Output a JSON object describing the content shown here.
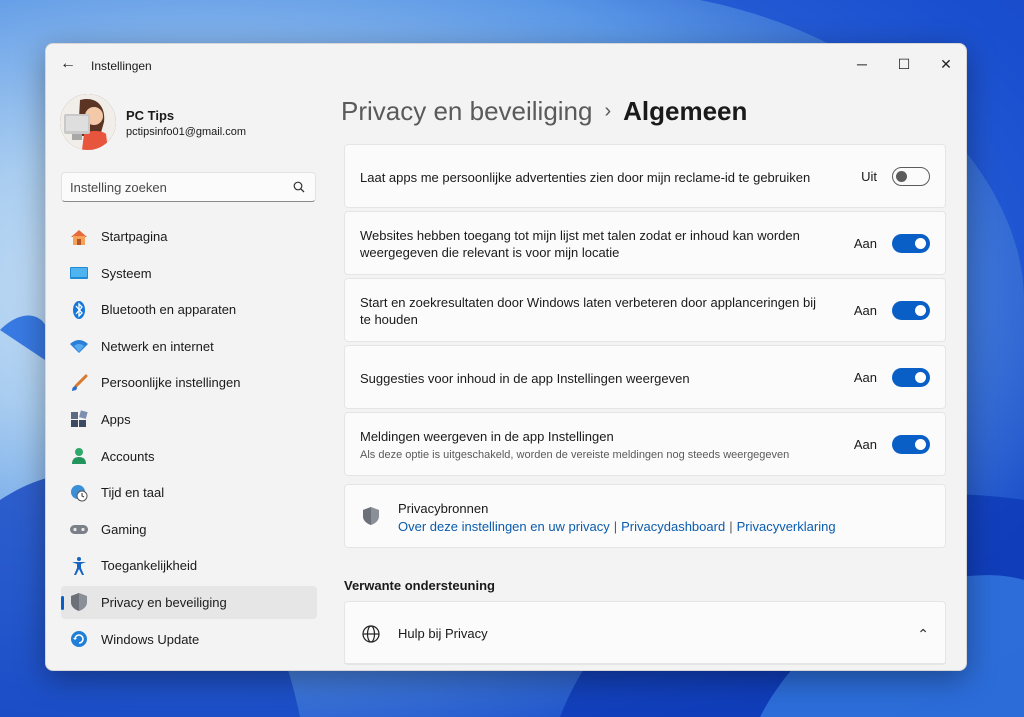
{
  "window": {
    "title": "Instellingen",
    "back_glyph": "←",
    "minimize_glyph": "─",
    "maximize_glyph": "☐",
    "close_glyph": "✕"
  },
  "profile": {
    "name": "PC Tips",
    "email": "pctipsinfo01@gmail.com"
  },
  "search": {
    "placeholder": "Instelling zoeken"
  },
  "sidebar": {
    "items": [
      {
        "label": "Startpagina",
        "icon": "home-icon"
      },
      {
        "label": "Systeem",
        "icon": "monitor-icon"
      },
      {
        "label": "Bluetooth en apparaten",
        "icon": "bluetooth-icon"
      },
      {
        "label": "Netwerk en internet",
        "icon": "wifi-icon"
      },
      {
        "label": "Persoonlijke instellingen",
        "icon": "brush-icon"
      },
      {
        "label": "Apps",
        "icon": "apps-icon"
      },
      {
        "label": "Accounts",
        "icon": "person-icon"
      },
      {
        "label": "Tijd en taal",
        "icon": "clock-globe-icon"
      },
      {
        "label": "Gaming",
        "icon": "gamepad-icon"
      },
      {
        "label": "Toegankelijkheid",
        "icon": "accessibility-icon"
      },
      {
        "label": "Privacy en beveiliging",
        "icon": "shield-icon",
        "active": true
      },
      {
        "label": "Windows Update",
        "icon": "update-icon"
      }
    ]
  },
  "breadcrumb": {
    "parent": "Privacy en beveiliging",
    "separator": "›",
    "current": "Algemeen"
  },
  "settings": [
    {
      "text": "Laat apps me persoonlijke advertenties zien door mijn reclame-id te gebruiken",
      "state": "Uit",
      "on": false
    },
    {
      "text": "Websites hebben toegang tot mijn lijst met talen zodat er inhoud kan worden weergegeven die relevant is voor mijn locatie",
      "state": "Aan",
      "on": true
    },
    {
      "text": "Start en zoekresultaten door Windows laten verbeteren door applanceringen bij te houden",
      "state": "Aan",
      "on": true
    },
    {
      "text": "Suggesties voor inhoud in de app Instellingen weergeven",
      "state": "Aan",
      "on": true
    },
    {
      "text": "Meldingen weergeven in de app Instellingen",
      "subtext": "Als deze optie is uitgeschakeld, worden de vereiste meldingen nog steeds weergegeven",
      "state": "Aan",
      "on": true
    }
  ],
  "privacy_resources": {
    "title": "Privacybronnen",
    "links": [
      "Over deze instellingen en uw privacy",
      "Privacydashboard",
      "Privacyverklaring"
    ],
    "separator": "|"
  },
  "related": {
    "heading": "Verwante ondersteuning",
    "help_label": "Hulp bij Privacy",
    "chevron": "⌃"
  },
  "colors": {
    "accent": "#0a5fc7",
    "link": "#0b5cad"
  }
}
